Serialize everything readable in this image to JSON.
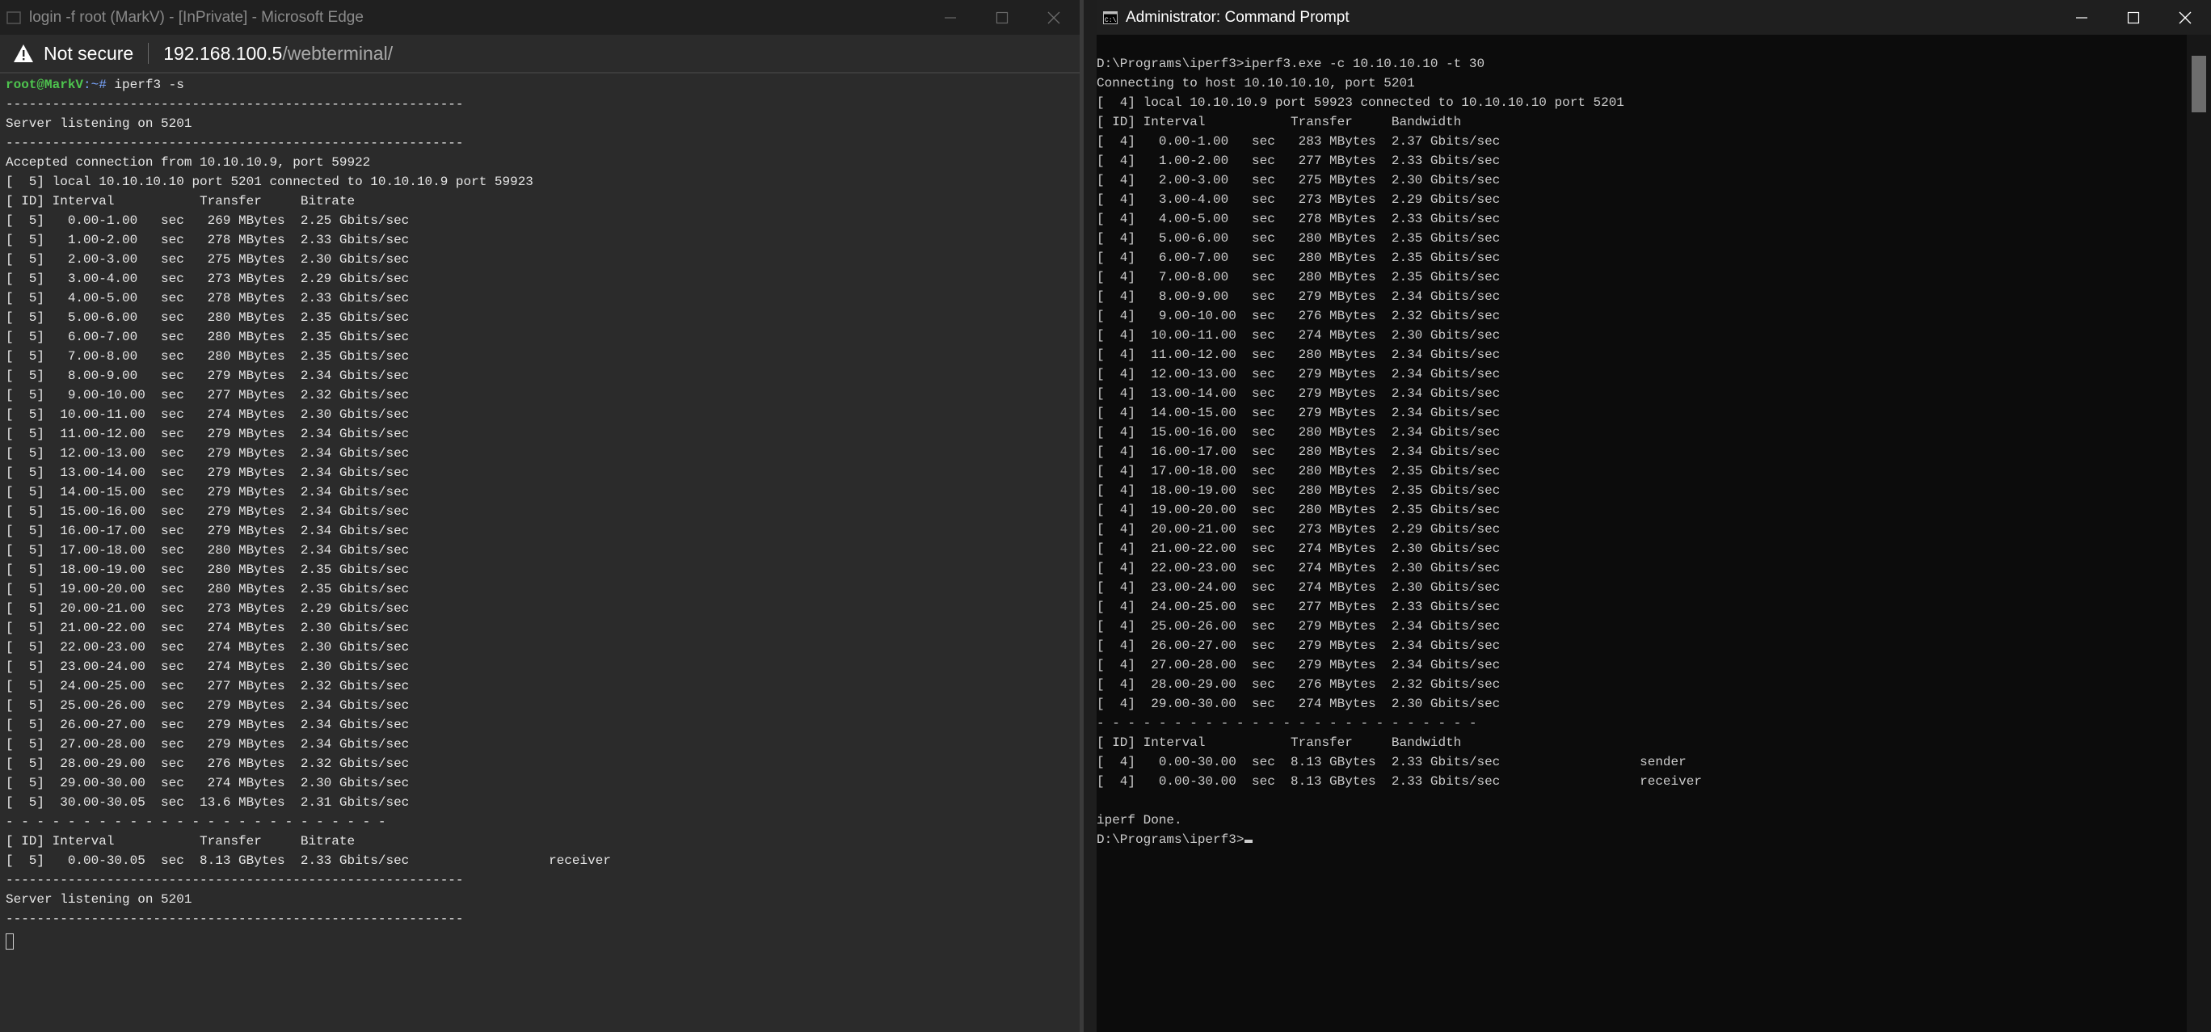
{
  "edge_window": {
    "title": "login -f root (MarkV) - [InPrivate] - Microsoft Edge",
    "security_label": "Not secure",
    "url_host": "192.168.100.5",
    "url_path": "/webterminal/",
    "terminal": {
      "prompt_user": "root@MarkV",
      "prompt_path": ":~#",
      "command": " iperf3 -s",
      "output": "-----------------------------------------------------------\nServer listening on 5201\n-----------------------------------------------------------\nAccepted connection from 10.10.10.9, port 59922\n[  5] local 10.10.10.10 port 5201 connected to 10.10.10.9 port 59923\n[ ID] Interval           Transfer     Bitrate\n[  5]   0.00-1.00   sec   269 MBytes  2.25 Gbits/sec\n[  5]   1.00-2.00   sec   278 MBytes  2.33 Gbits/sec\n[  5]   2.00-3.00   sec   275 MBytes  2.30 Gbits/sec\n[  5]   3.00-4.00   sec   273 MBytes  2.29 Gbits/sec\n[  5]   4.00-5.00   sec   278 MBytes  2.33 Gbits/sec\n[  5]   5.00-6.00   sec   280 MBytes  2.35 Gbits/sec\n[  5]   6.00-7.00   sec   280 MBytes  2.35 Gbits/sec\n[  5]   7.00-8.00   sec   280 MBytes  2.35 Gbits/sec\n[  5]   8.00-9.00   sec   279 MBytes  2.34 Gbits/sec\n[  5]   9.00-10.00  sec   277 MBytes  2.32 Gbits/sec\n[  5]  10.00-11.00  sec   274 MBytes  2.30 Gbits/sec\n[  5]  11.00-12.00  sec   279 MBytes  2.34 Gbits/sec\n[  5]  12.00-13.00  sec   279 MBytes  2.34 Gbits/sec\n[  5]  13.00-14.00  sec   279 MBytes  2.34 Gbits/sec\n[  5]  14.00-15.00  sec   279 MBytes  2.34 Gbits/sec\n[  5]  15.00-16.00  sec   279 MBytes  2.34 Gbits/sec\n[  5]  16.00-17.00  sec   279 MBytes  2.34 Gbits/sec\n[  5]  17.00-18.00  sec   280 MBytes  2.34 Gbits/sec\n[  5]  18.00-19.00  sec   280 MBytes  2.35 Gbits/sec\n[  5]  19.00-20.00  sec   280 MBytes  2.35 Gbits/sec\n[  5]  20.00-21.00  sec   273 MBytes  2.29 Gbits/sec\n[  5]  21.00-22.00  sec   274 MBytes  2.30 Gbits/sec\n[  5]  22.00-23.00  sec   274 MBytes  2.30 Gbits/sec\n[  5]  23.00-24.00  sec   274 MBytes  2.30 Gbits/sec\n[  5]  24.00-25.00  sec   277 MBytes  2.32 Gbits/sec\n[  5]  25.00-26.00  sec   279 MBytes  2.34 Gbits/sec\n[  5]  26.00-27.00  sec   279 MBytes  2.34 Gbits/sec\n[  5]  27.00-28.00  sec   279 MBytes  2.34 Gbits/sec\n[  5]  28.00-29.00  sec   276 MBytes  2.32 Gbits/sec\n[  5]  29.00-30.00  sec   274 MBytes  2.30 Gbits/sec\n[  5]  30.00-30.05  sec  13.6 MBytes  2.31 Gbits/sec\n- - - - - - - - - - - - - - - - - - - - - - - - -\n[ ID] Interval           Transfer     Bitrate\n[  5]   0.00-30.05  sec  8.13 GBytes  2.33 Gbits/sec                  receiver\n-----------------------------------------------------------\nServer listening on 5201\n-----------------------------------------------------------"
    }
  },
  "cmd_window": {
    "title": "Administrator: Command Prompt",
    "terminal": {
      "output": "D:\\Programs\\iperf3>iperf3.exe -c 10.10.10.10 -t 30\nConnecting to host 10.10.10.10, port 5201\n[  4] local 10.10.10.9 port 59923 connected to 10.10.10.10 port 5201\n[ ID] Interval           Transfer     Bandwidth\n[  4]   0.00-1.00   sec   283 MBytes  2.37 Gbits/sec\n[  4]   1.00-2.00   sec   277 MBytes  2.33 Gbits/sec\n[  4]   2.00-3.00   sec   275 MBytes  2.30 Gbits/sec\n[  4]   3.00-4.00   sec   273 MBytes  2.29 Gbits/sec\n[  4]   4.00-5.00   sec   278 MBytes  2.33 Gbits/sec\n[  4]   5.00-6.00   sec   280 MBytes  2.35 Gbits/sec\n[  4]   6.00-7.00   sec   280 MBytes  2.35 Gbits/sec\n[  4]   7.00-8.00   sec   280 MBytes  2.35 Gbits/sec\n[  4]   8.00-9.00   sec   279 MBytes  2.34 Gbits/sec\n[  4]   9.00-10.00  sec   276 MBytes  2.32 Gbits/sec\n[  4]  10.00-11.00  sec   274 MBytes  2.30 Gbits/sec\n[  4]  11.00-12.00  sec   280 MBytes  2.34 Gbits/sec\n[  4]  12.00-13.00  sec   279 MBytes  2.34 Gbits/sec\n[  4]  13.00-14.00  sec   279 MBytes  2.34 Gbits/sec\n[  4]  14.00-15.00  sec   279 MBytes  2.34 Gbits/sec\n[  4]  15.00-16.00  sec   280 MBytes  2.34 Gbits/sec\n[  4]  16.00-17.00  sec   280 MBytes  2.34 Gbits/sec\n[  4]  17.00-18.00  sec   280 MBytes  2.35 Gbits/sec\n[  4]  18.00-19.00  sec   280 MBytes  2.35 Gbits/sec\n[  4]  19.00-20.00  sec   280 MBytes  2.35 Gbits/sec\n[  4]  20.00-21.00  sec   273 MBytes  2.29 Gbits/sec\n[  4]  21.00-22.00  sec   274 MBytes  2.30 Gbits/sec\n[  4]  22.00-23.00  sec   274 MBytes  2.30 Gbits/sec\n[  4]  23.00-24.00  sec   274 MBytes  2.30 Gbits/sec\n[  4]  24.00-25.00  sec   277 MBytes  2.33 Gbits/sec\n[  4]  25.00-26.00  sec   279 MBytes  2.34 Gbits/sec\n[  4]  26.00-27.00  sec   279 MBytes  2.34 Gbits/sec\n[  4]  27.00-28.00  sec   279 MBytes  2.34 Gbits/sec\n[  4]  28.00-29.00  sec   276 MBytes  2.32 Gbits/sec\n[  4]  29.00-30.00  sec   274 MBytes  2.30 Gbits/sec\n- - - - - - - - - - - - - - - - - - - - - - - - -\n[ ID] Interval           Transfer     Bandwidth\n[  4]   0.00-30.00  sec  8.13 GBytes  2.33 Gbits/sec                  sender\n[  4]   0.00-30.00  sec  8.13 GBytes  2.33 Gbits/sec                  receiver\n\niperf Done.\n",
      "prompt": "D:\\Programs\\iperf3>"
    }
  }
}
